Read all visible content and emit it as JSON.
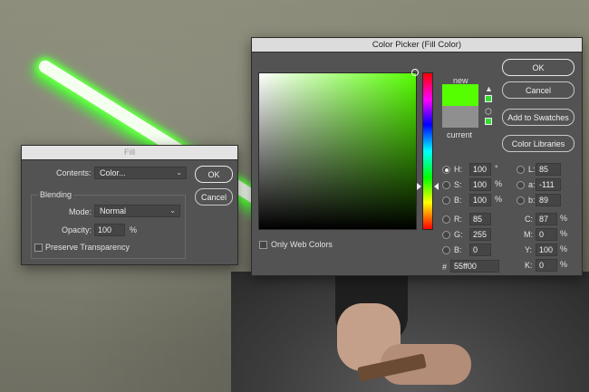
{
  "fill_dialog": {
    "title": "Fill",
    "contents_label": "Contents:",
    "contents_value": "Color...",
    "ok": "OK",
    "cancel": "Cancel",
    "blending_label": "Blending",
    "mode_label": "Mode:",
    "mode_value": "Normal",
    "opacity_label": "Opacity:",
    "opacity_value": "100",
    "opacity_unit": "%",
    "preserve_label": "Preserve Transparency"
  },
  "color_picker": {
    "title": "Color Picker (Fill Color)",
    "ok": "OK",
    "cancel": "Cancel",
    "add_swatches": "Add to Swatches",
    "color_libraries": "Color Libraries",
    "new_label": "new",
    "current_label": "current",
    "new_color": "#55ff00",
    "current_color": "#8f8f8f",
    "only_web_colors": "Only Web Colors",
    "hsb": [
      {
        "label": "H:",
        "value": "100",
        "unit": "°"
      },
      {
        "label": "S:",
        "value": "100",
        "unit": "%"
      },
      {
        "label": "B:",
        "value": "100",
        "unit": "%"
      }
    ],
    "rgb": [
      {
        "label": "R:",
        "value": "85"
      },
      {
        "label": "G:",
        "value": "255"
      },
      {
        "label": "B:",
        "value": "0"
      }
    ],
    "lab": [
      {
        "label": "L:",
        "value": "85"
      },
      {
        "label": "a:",
        "value": "-111"
      },
      {
        "label": "b:",
        "value": "89"
      }
    ],
    "cmyk": [
      {
        "label": "C:",
        "value": "87",
        "unit": "%"
      },
      {
        "label": "M:",
        "value": "0",
        "unit": "%"
      },
      {
        "label": "Y:",
        "value": "100",
        "unit": "%"
      },
      {
        "label": "K:",
        "value": "0",
        "unit": "%"
      }
    ],
    "hex_label": "#",
    "hex_value": "55ff00"
  }
}
